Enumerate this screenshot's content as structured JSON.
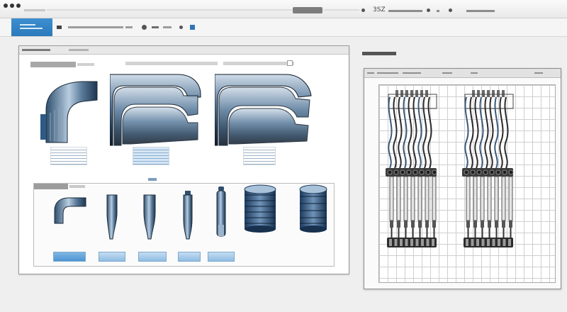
{
  "titlebar": {
    "window_controls": [
      "close",
      "minimize",
      "zoom"
    ],
    "right_text": "3SZ"
  },
  "toolbar": {
    "active_tool_icon": "layers-icon",
    "tools": [
      "tool-1",
      "tool-2",
      "tool-3",
      "tool-4",
      "tool-5",
      "tool-6",
      "tool-7"
    ]
  },
  "design_window": {
    "parts": [
      "bent-connector",
      "wide-elbow-left",
      "wide-elbow-right",
      "small-elbow",
      "slim-pin",
      "slim-pin-2",
      "narrow-pin",
      "tall-pin",
      "cylinder",
      "cylinder-2"
    ]
  },
  "harness_window": {
    "harness_count": 2
  },
  "colors": {
    "accent": "#2b79bb",
    "part_steel": "#4f6f8f",
    "part_highlight": "#b8cde0",
    "cable_dark": "#2a2a2a"
  }
}
